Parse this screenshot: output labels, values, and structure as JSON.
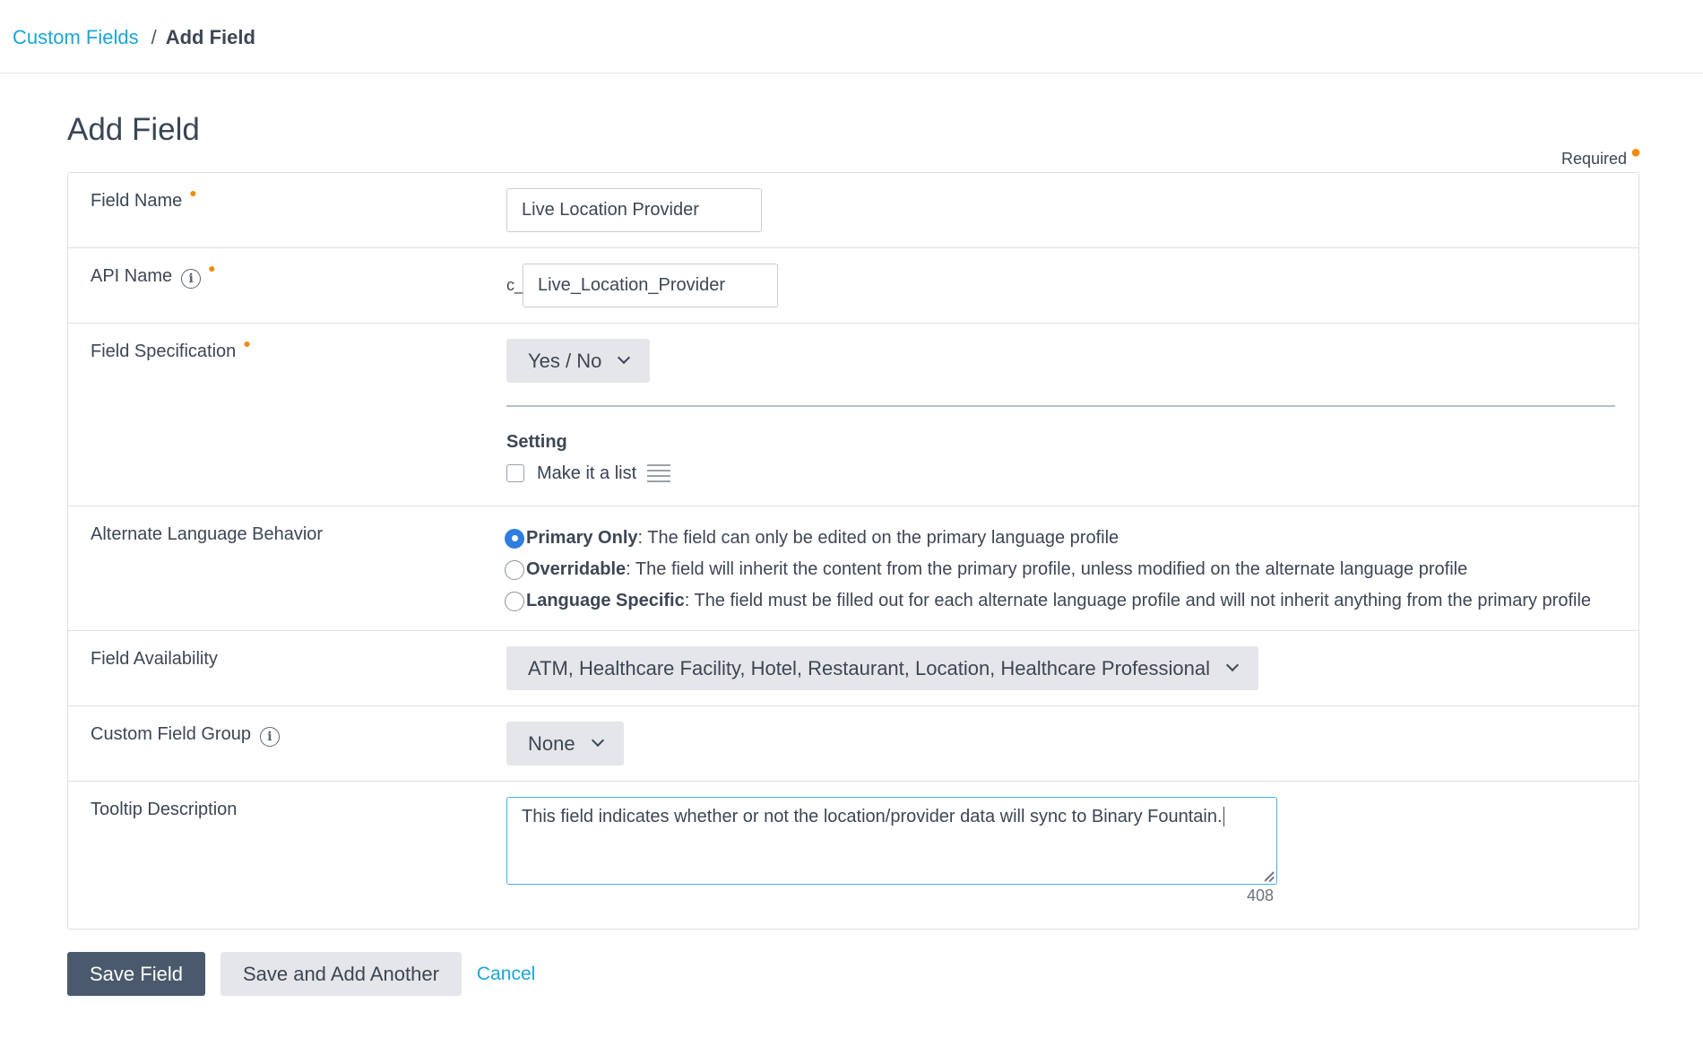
{
  "breadcrumb": {
    "parent": "Custom Fields",
    "separator": "/",
    "current": "Add Field"
  },
  "page": {
    "title": "Add Field",
    "required_note": "Required"
  },
  "fields": {
    "field_name": {
      "label": "Field Name",
      "value": "Live Location Provider"
    },
    "api_name": {
      "label": "API Name",
      "prefix": "c_",
      "value": "Live_Location_Provider"
    },
    "field_specification": {
      "label": "Field Specification",
      "selected": "Yes / No",
      "setting_title": "Setting",
      "make_list_label": "Make it a list",
      "make_list_checked": false
    },
    "alternate_language": {
      "label": "Alternate Language Behavior",
      "options": [
        {
          "title": "Primary Only",
          "desc": ": The field can only be edited on the primary language profile",
          "selected": true
        },
        {
          "title": "Overridable",
          "desc": ": The field will inherit the content from the primary profile, unless modified on the alternate language profile",
          "selected": false
        },
        {
          "title": "Language Specific",
          "desc": ": The field must be filled out for each alternate language profile and will not inherit anything from the primary profile",
          "selected": false
        }
      ]
    },
    "field_availability": {
      "label": "Field Availability",
      "selected": "ATM, Healthcare Facility, Hotel, Restaurant, Location, Healthcare Professional"
    },
    "custom_field_group": {
      "label": "Custom Field Group",
      "selected": "None"
    },
    "tooltip_description": {
      "label": "Tooltip Description",
      "value": "This field indicates whether or not the location/provider data will sync to Binary Fountain.",
      "remaining": "408"
    }
  },
  "actions": {
    "save": "Save Field",
    "save_add": "Save and Add Another",
    "cancel": "Cancel"
  },
  "colors": {
    "accent_link": "#1aa6d6",
    "required_dot": "#f58a07",
    "primary_button": "#4a5a6c",
    "radio_selected": "#2f7de1",
    "focus_border": "#3bb5e3"
  },
  "icons": [
    "info-icon",
    "chevron-down-icon",
    "list-icon",
    "resize-handle-icon"
  ]
}
